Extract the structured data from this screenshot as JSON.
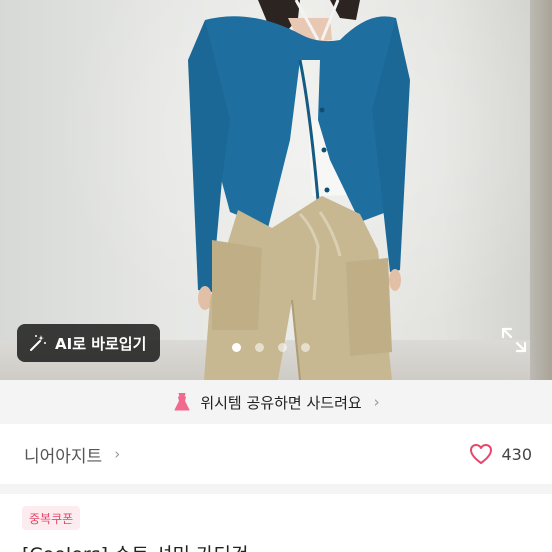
{
  "hero": {
    "ai_button_label": "AI로 바로입기",
    "slide_count": 4,
    "active_slide": 1
  },
  "wish_banner": {
    "text": "위시템 공유하면 사드려요",
    "chevron": "›"
  },
  "shop": {
    "name": "니어아지트",
    "chevron": "›",
    "like_count": "430"
  },
  "product": {
    "coupon_badge": "중복쿠폰",
    "title": "[Coolers] 슈트 셔미 가디건"
  },
  "colors": {
    "accent_pink": "#e5486a",
    "coupon_bg": "#fdecef"
  },
  "icons": [
    "magic-wand-icon",
    "expand-icon",
    "dress-icon",
    "heart-icon",
    "chevron-right-icon"
  ]
}
